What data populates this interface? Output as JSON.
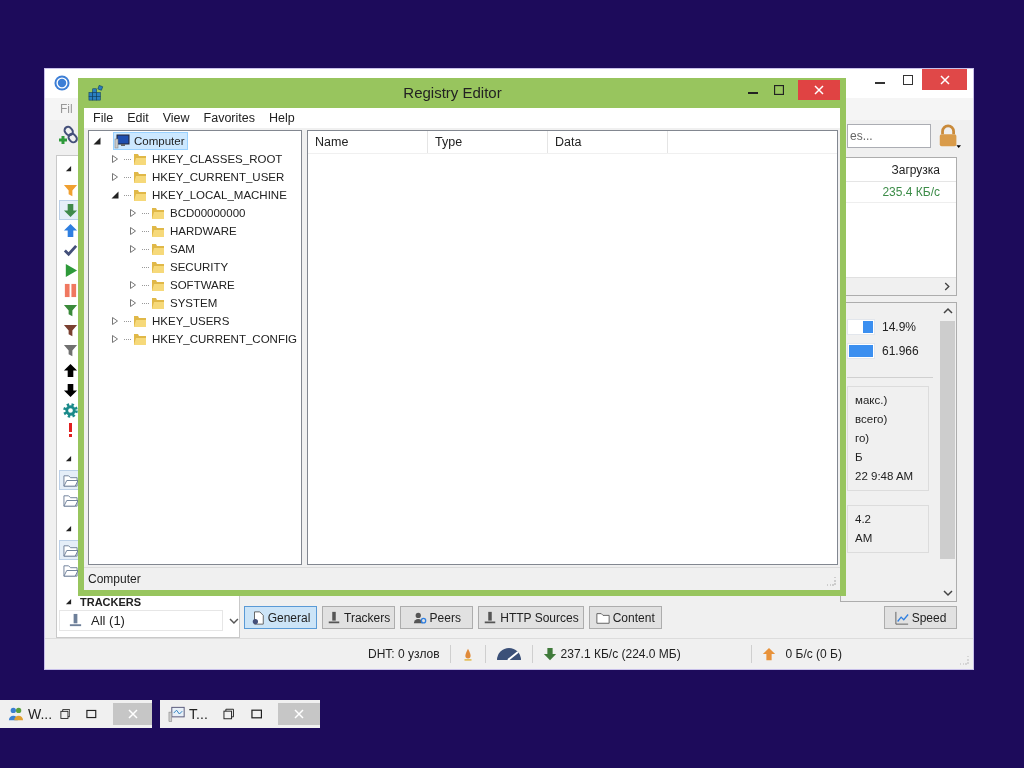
{
  "background_window": {
    "menu": [
      "Fil"
    ],
    "search": {
      "placeholder": "es..."
    },
    "sidebar": {
      "sections": [
        {
          "items": [
            {
              "selected": false
            },
            {
              "selected": true
            },
            {
              "selected": false
            },
            {
              "selected": false
            },
            {
              "selected": false
            },
            {
              "selected": false
            },
            {
              "selected": false
            },
            {
              "selected": false
            },
            {
              "selected": false
            },
            {
              "selected": false
            },
            {
              "selected": false
            },
            {
              "selected": false
            },
            {
              "selected": false
            }
          ]
        },
        {
          "items": [
            {
              "selected": true
            },
            {
              "selected": false
            }
          ]
        },
        {
          "items": [
            {
              "selected": true
            },
            {
              "selected": false
            }
          ]
        }
      ],
      "trackers": {
        "title": "TRACKERS",
        "items": [
          {
            "label": "All (1)"
          }
        ]
      }
    },
    "torrent_list": {
      "columns": [
        "Загрузка"
      ],
      "rows": [
        [
          "235.4 КБ/с"
        ]
      ]
    },
    "properties": {
      "bars": [
        {
          "level": 0.4,
          "reading": "14.9%"
        },
        {
          "level": 1,
          "reading": "61.966"
        }
      ],
      "groups": [
        [
          "макс.)",
          "всего)",
          "го)",
          "Б",
          "22 9:48 AM"
        ],
        [
          "4.2",
          "AM"
        ]
      ]
    },
    "tabs": [
      {
        "label": "General",
        "selected": true
      },
      {
        "label": "Trackers",
        "selected": false
      },
      {
        "label": "Peers",
        "selected": false
      },
      {
        "label": "HTTP Sources",
        "selected": false
      },
      {
        "label": "Content",
        "selected": false
      },
      {
        "label": "Speed",
        "selected": false
      }
    ],
    "status_bar": {
      "dht": "DHT: 0 узлов",
      "download": "237.1 КБ/с (224.0 МБ)",
      "upload": "0 Б/с (0 Б)"
    }
  },
  "registry_editor": {
    "title": "Registry Editor",
    "menu": [
      "File",
      "Edit",
      "View",
      "Favorites",
      "Help"
    ],
    "tree": [
      {
        "label": "Computer",
        "selected": true,
        "expandable": true,
        "expanded": true,
        "children": [
          {
            "label": "HKEY_CLASSES_ROOT",
            "selected": false,
            "expandable": true,
            "expanded": false
          },
          {
            "label": "HKEY_CURRENT_USER",
            "selected": false,
            "expandable": true,
            "expanded": false
          },
          {
            "label": "HKEY_LOCAL_MACHINE",
            "selected": false,
            "expandable": true,
            "expanded": true,
            "children": [
              {
                "label": "BCD00000000",
                "selected": false,
                "expandable": true,
                "expanded": false
              },
              {
                "label": "HARDWARE",
                "selected": false,
                "expandable": true,
                "expanded": false
              },
              {
                "label": "SAM",
                "selected": false,
                "expandable": true,
                "expanded": false
              },
              {
                "label": "SECURITY",
                "selected": false,
                "expandable": false
              },
              {
                "label": "SOFTWARE",
                "selected": false,
                "expandable": true,
                "expanded": false
              },
              {
                "label": "SYSTEM",
                "selected": false,
                "expandable": true,
                "expanded": false
              }
            ]
          },
          {
            "label": "HKEY_USERS",
            "selected": false,
            "expandable": true,
            "expanded": false
          },
          {
            "label": "HKEY_CURRENT_CONFIG",
            "selected": false,
            "expandable": true,
            "expanded": false
          }
        ]
      }
    ],
    "columns": [
      "Name",
      "Type",
      "Data"
    ],
    "status_bar": "Computer"
  },
  "minimized_windows": [
    {
      "title": "W..."
    },
    {
      "title": "T..."
    }
  ]
}
